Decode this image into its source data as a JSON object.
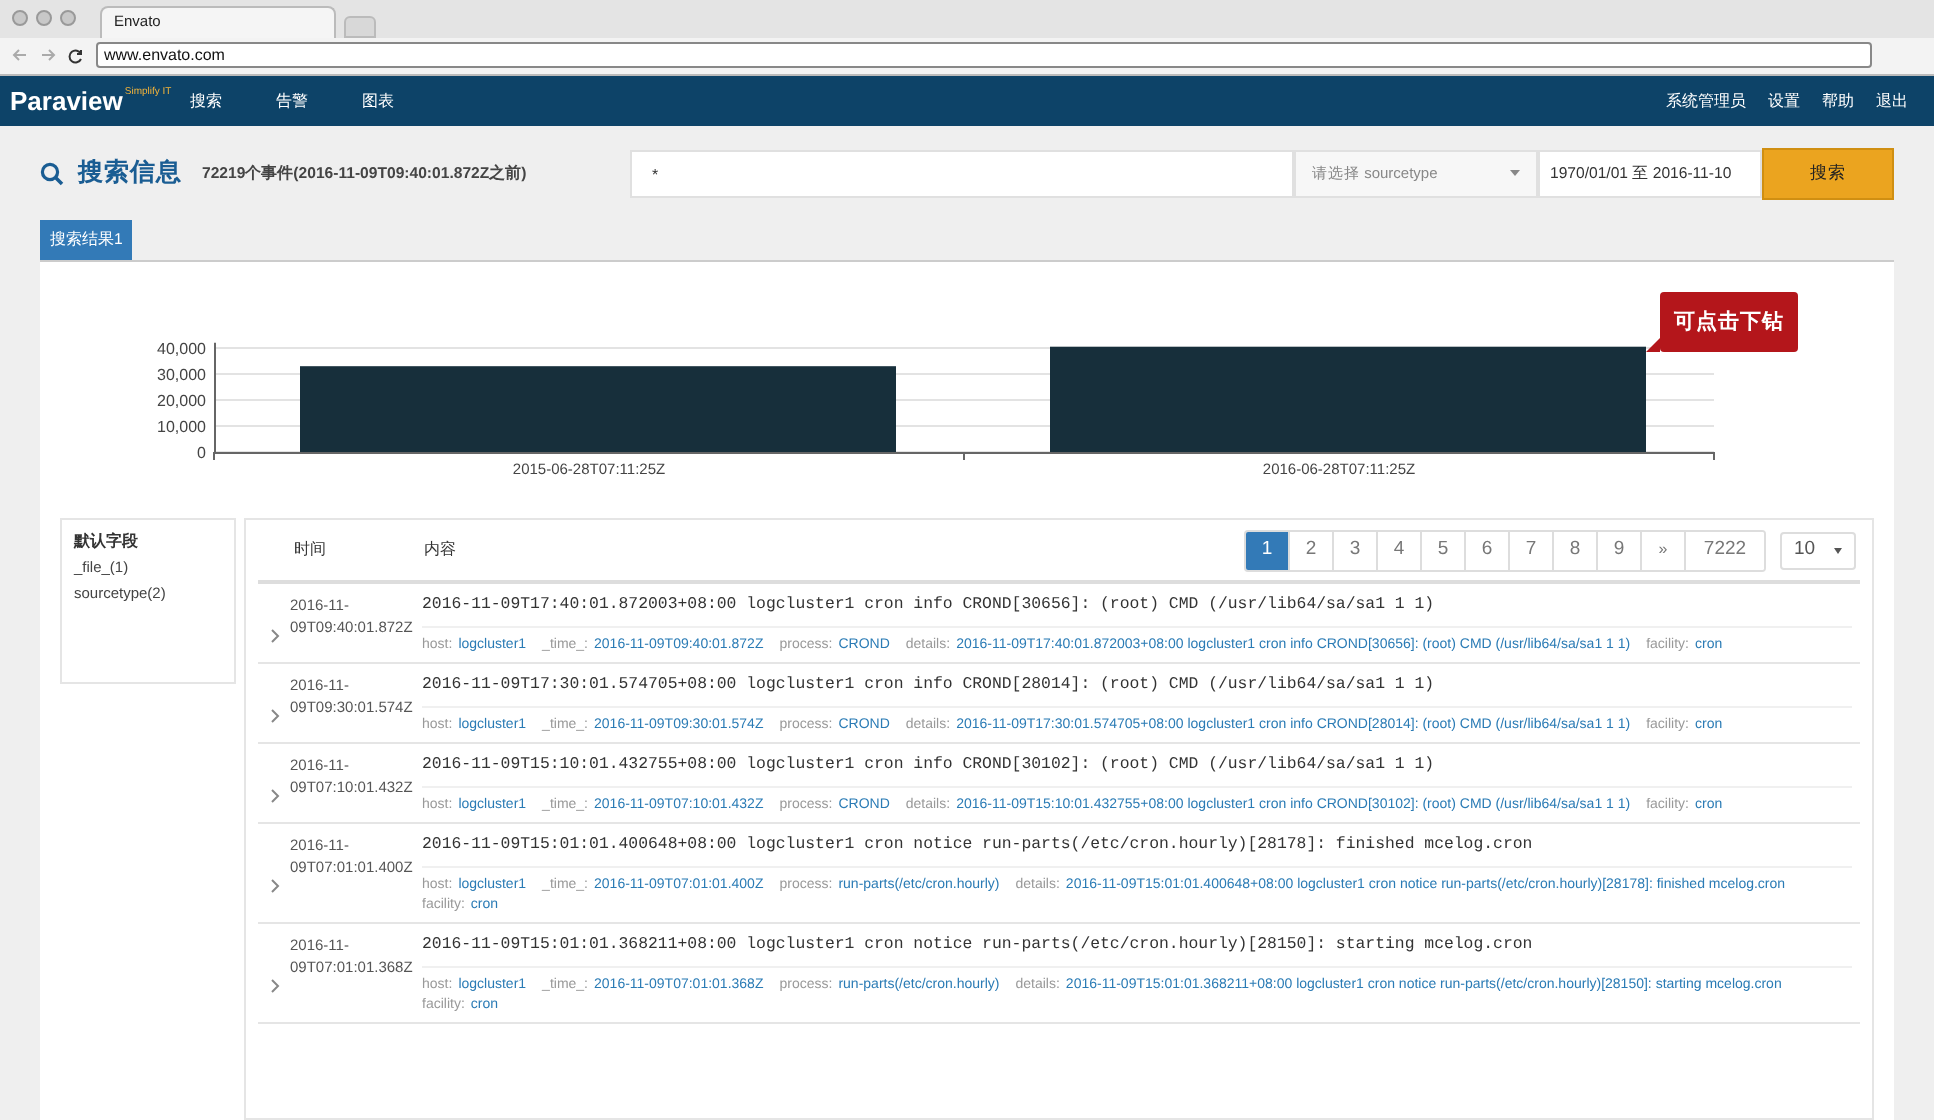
{
  "browser": {
    "tab_title": "Envato",
    "url": "www.envato.com"
  },
  "navbar": {
    "logo": "Paraview",
    "logo_tagline": "Simplify IT",
    "items": [
      {
        "label": "搜索"
      },
      {
        "label": "告警"
      },
      {
        "label": "图表"
      }
    ],
    "right_items": [
      {
        "label": "系统管理员"
      },
      {
        "label": "设置"
      },
      {
        "label": "帮助"
      },
      {
        "label": "退出"
      }
    ]
  },
  "search": {
    "title": "搜索信息",
    "summary": "72219个事件(2016-11-09T09:40:01.872Z之前)",
    "query": "*",
    "sourcetype_placeholder": "请选择 sourcetype",
    "date_range": "1970/01/01 至 2016-11-10",
    "button": "搜索"
  },
  "tabs": [
    {
      "label": "搜索结果1",
      "selected": true
    }
  ],
  "chart": {
    "tooltip": "可点击下钻",
    "chart_data": {
      "type": "bar",
      "categories": [
        "2015-06-28T07:11:25Z",
        "2016-06-28T07:11:25Z"
      ],
      "series": [
        {
          "color": "#172f3b",
          "values": [
            33000,
            40500
          ]
        }
      ],
      "ylim": [
        0,
        42000
      ],
      "grid": true,
      "yticks": [
        {
          "value": 0,
          "label": "0"
        },
        {
          "value": 10000,
          "label": "10,000"
        },
        {
          "value": 20000,
          "label": "20,000"
        },
        {
          "value": 30000,
          "label": "30,000"
        },
        {
          "value": 40000,
          "label": "40,000"
        }
      ]
    }
  },
  "sidebar": {
    "title": "默认字段",
    "items": [
      {
        "label": "_file_(1)"
      },
      {
        "label": "sourcetype(2)"
      }
    ]
  },
  "table": {
    "columns": [
      "时间",
      "内容"
    ],
    "pagination": {
      "pages": [
        {
          "label": "1",
          "selected": true
        },
        {
          "label": "2",
          "selected": false
        },
        {
          "label": "3",
          "selected": false
        },
        {
          "label": "4",
          "selected": false
        },
        {
          "label": "5",
          "selected": false
        },
        {
          "label": "6",
          "selected": false
        },
        {
          "label": "7",
          "selected": false
        },
        {
          "label": "8",
          "selected": false
        },
        {
          "label": "9",
          "selected": false
        }
      ],
      "next": "»",
      "last": "7222",
      "page_size": "10"
    },
    "rows": [
      {
        "time_lines": [
          "2016-11-",
          "09T09:40:01.872Z"
        ],
        "message": "2016-11-09T17:40:01.872003+08:00 logcluster1 cron info CROND[30656]: (root) CMD (/usr/lib64/sa/sa1 1 1)",
        "fields": [
          {
            "key": "host:",
            "value": "logcluster1"
          },
          {
            "key": "_time_:",
            "value": "2016-11-09T09:40:01.872Z"
          },
          {
            "key": "process:",
            "value": "CROND"
          },
          {
            "key": "details:",
            "value": "2016-11-09T17:40:01.872003+08:00 logcluster1 cron info CROND[30656]: (root) CMD (/usr/lib64/sa/sa1 1 1)"
          },
          {
            "key": "facility:",
            "value": "cron"
          }
        ]
      },
      {
        "time_lines": [
          "2016-11-",
          "09T09:30:01.574Z"
        ],
        "message": "2016-11-09T17:30:01.574705+08:00 logcluster1 cron info CROND[28014]: (root) CMD (/usr/lib64/sa/sa1 1 1)",
        "fields": [
          {
            "key": "host:",
            "value": "logcluster1"
          },
          {
            "key": "_time_:",
            "value": "2016-11-09T09:30:01.574Z"
          },
          {
            "key": "process:",
            "value": "CROND"
          },
          {
            "key": "details:",
            "value": "2016-11-09T17:30:01.574705+08:00 logcluster1 cron info CROND[28014]: (root) CMD (/usr/lib64/sa/sa1 1 1)"
          },
          {
            "key": "facility:",
            "value": "cron"
          }
        ]
      },
      {
        "time_lines": [
          "2016-11-",
          "09T07:10:01.432Z"
        ],
        "message": "2016-11-09T15:10:01.432755+08:00 logcluster1 cron info CROND[30102]: (root) CMD (/usr/lib64/sa/sa1 1 1)",
        "fields": [
          {
            "key": "host:",
            "value": "logcluster1"
          },
          {
            "key": "_time_:",
            "value": "2016-11-09T07:10:01.432Z"
          },
          {
            "key": "process:",
            "value": "CROND"
          },
          {
            "key": "details:",
            "value": "2016-11-09T15:10:01.432755+08:00 logcluster1 cron info CROND[30102]: (root) CMD (/usr/lib64/sa/sa1 1 1)"
          },
          {
            "key": "facility:",
            "value": "cron"
          }
        ]
      },
      {
        "time_lines": [
          "2016-11-",
          "09T07:01:01.400Z"
        ],
        "message": "2016-11-09T15:01:01.400648+08:00 logcluster1 cron notice run-parts(/etc/cron.hourly)[28178]: finished mcelog.cron",
        "fields": [
          {
            "key": "host:",
            "value": "logcluster1"
          },
          {
            "key": "_time_:",
            "value": "2016-11-09T07:01:01.400Z"
          },
          {
            "key": "process:",
            "value": "run-parts(/etc/cron.hourly)"
          },
          {
            "key": "details:",
            "value": "2016-11-09T15:01:01.400648+08:00 logcluster1 cron notice run-parts(/etc/cron.hourly)[28178]: finished mcelog.cron"
          },
          {
            "key": "facility:",
            "value": "cron"
          }
        ]
      },
      {
        "time_lines": [
          "2016-11-",
          "09T07:01:01.368Z"
        ],
        "message": "2016-11-09T15:01:01.368211+08:00 logcluster1 cron notice run-parts(/etc/cron.hourly)[28150]: starting mcelog.cron",
        "fields": [
          {
            "key": "host:",
            "value": "logcluster1"
          },
          {
            "key": "_time_:",
            "value": "2016-11-09T07:01:01.368Z"
          },
          {
            "key": "process:",
            "value": "run-parts(/etc/cron.hourly)"
          },
          {
            "key": "details:",
            "value": "2016-11-09T15:01:01.368211+08:00 logcluster1 cron notice run-parts(/etc/cron.hourly)[28150]: starting mcelog.cron"
          },
          {
            "key": "facility:",
            "value": "cron"
          }
        ]
      }
    ]
  }
}
